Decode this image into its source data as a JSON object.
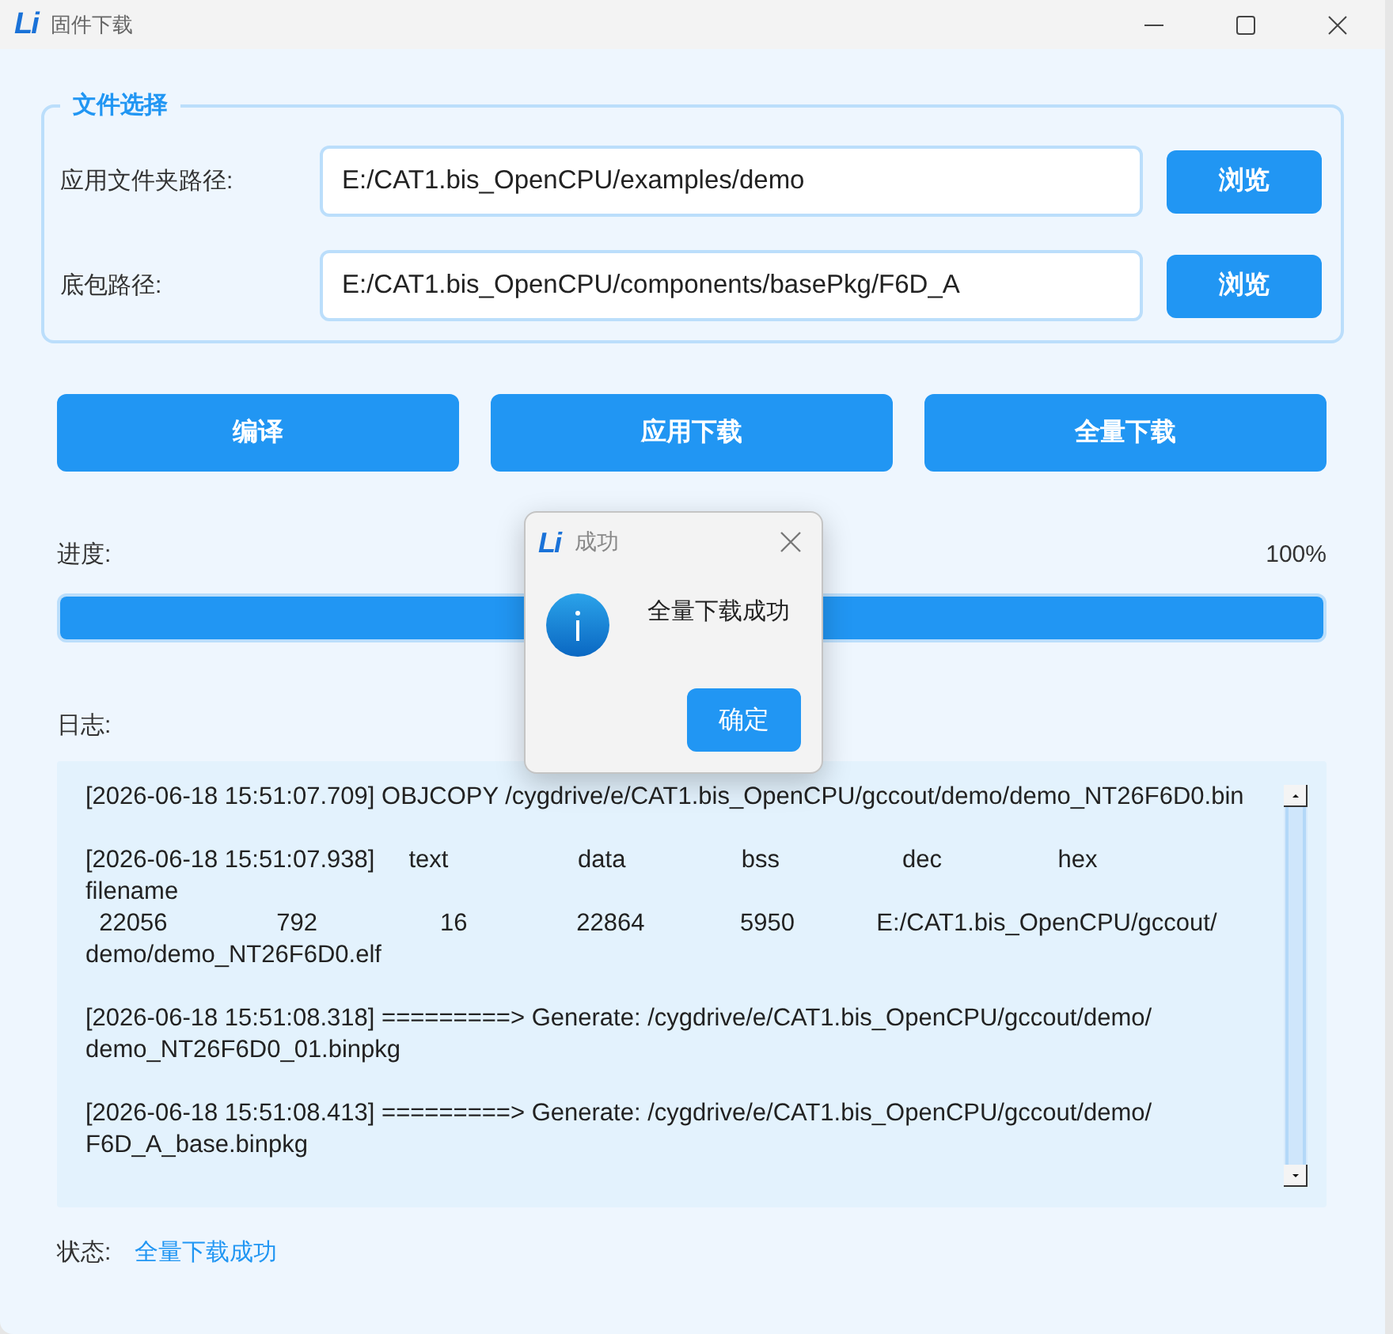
{
  "window": {
    "logo": "Li",
    "title": "固件下载"
  },
  "file_selection": {
    "legend": "文件选择",
    "rows": [
      {
        "label": "应用文件夹路径:",
        "value": "E:/CAT1.bis_OpenCPU/examples/demo",
        "button": "浏览"
      },
      {
        "label": "底包路径:",
        "value": "E:/CAT1.bis_OpenCPU/components/basePkg/F6D_A",
        "button": "浏览"
      }
    ]
  },
  "actions": [
    "编译",
    "应用下载",
    "全量下载"
  ],
  "progress": {
    "label": "进度:",
    "reading": "100%",
    "level": 1
  },
  "log": {
    "label": "日志:",
    "entries": [
      {
        "lines": [
          "[2026-06-18 15:51:07.709] OBJCOPY /cygdrive/e/CAT1.bis_OpenCPU/gccout/demo/demo_NT26F6D0.bin"
        ]
      },
      {
        "lines": [
          "[2026-06-18 15:51:07.938]     text                   data                 bss                  dec                 hex",
          "filename",
          "  22056                792                  16                22864              5950            E:/CAT1.bis_OpenCPU/gccout/",
          "demo/demo_NT26F6D0.elf"
        ]
      },
      {
        "lines": [
          "[2026-06-18 15:51:08.318] =========> Generate: /cygdrive/e/CAT1.bis_OpenCPU/gccout/demo/",
          "demo_NT26F6D0_01.binpkg"
        ]
      },
      {
        "lines": [
          "[2026-06-18 15:51:08.413] =========> Generate: /cygdrive/e/CAT1.bis_OpenCPU/gccout/demo/",
          "F6D_A_base.binpkg"
        ]
      }
    ]
  },
  "status": {
    "label": "状态:",
    "value": "全量下载成功"
  },
  "dialog": {
    "logo": "Li",
    "title": "成功",
    "message": "全量下载成功",
    "button": "确定"
  }
}
